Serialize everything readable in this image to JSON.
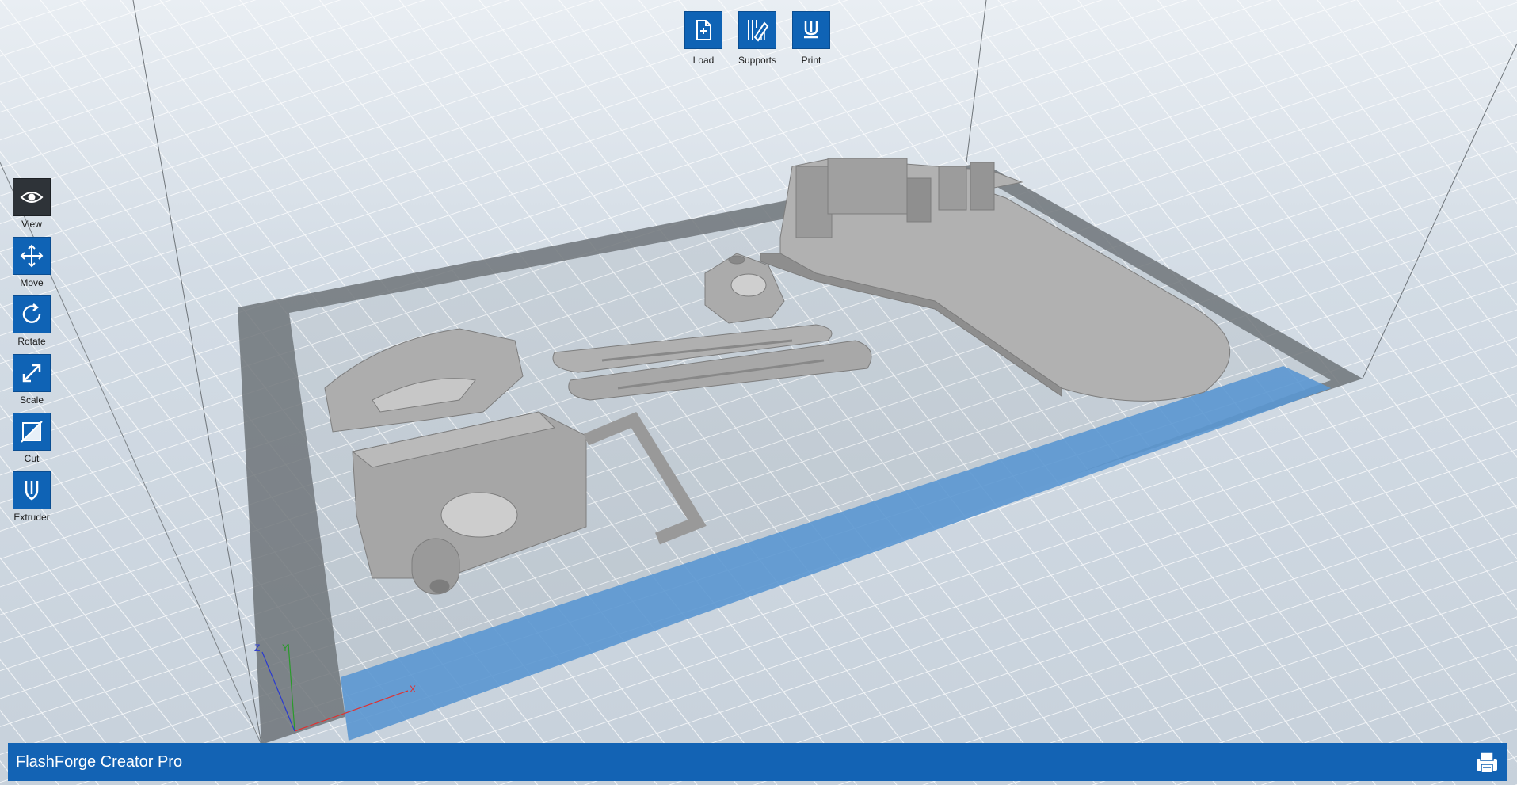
{
  "toolbar_top": {
    "load_label": "Load",
    "supports_label": "Supports",
    "print_label": "Print"
  },
  "toolbar_left": {
    "view_label": "View",
    "move_label": "Move",
    "rotate_label": "Rotate",
    "scale_label": "Scale",
    "cut_label": "Cut",
    "extruder_label": "Extruder"
  },
  "axes": {
    "x_label": "X",
    "y_label": "Y",
    "z_label": "Z"
  },
  "status_bar": {
    "printer_name": "FlashForge Creator Pro"
  },
  "icons": {
    "load": "file-plus-icon",
    "supports": "supports-icon",
    "print": "print-icon",
    "view": "eye-icon",
    "move": "move-arrows-icon",
    "rotate": "rotate-icon",
    "scale": "scale-icon",
    "cut": "cut-icon",
    "extruder": "extruder-icon",
    "printer_settings": "printer-icon"
  },
  "colors": {
    "accent": "#1363b4",
    "active_tool": "#2e3338",
    "build_plate_highlight": "#5b97d1"
  }
}
